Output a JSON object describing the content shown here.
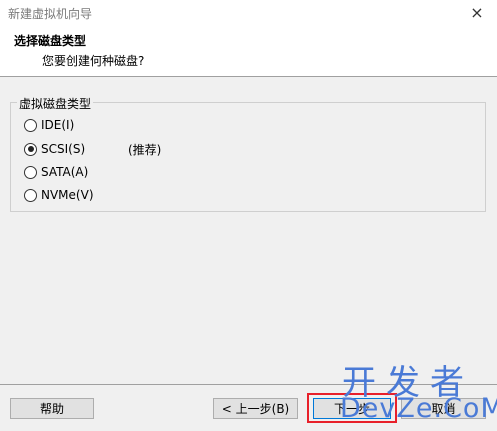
{
  "window": {
    "title": "新建虚拟机向导",
    "close_glyph": "×"
  },
  "header": {
    "title": "选择磁盘类型",
    "subtitle": "您要创建何种磁盘?"
  },
  "disk_type": {
    "group_label": "虚拟磁盘类型",
    "options": [
      {
        "label": "IDE(I)",
        "checked": false
      },
      {
        "label": "SCSI(S)",
        "checked": true,
        "note": "(推荐)"
      },
      {
        "label": "SATA(A)",
        "checked": false
      },
      {
        "label": "NVMe(V)",
        "checked": false
      }
    ]
  },
  "buttons": {
    "help": "帮助",
    "back": "< 上一步(B)",
    "next": "下一步",
    "cancel": "取消"
  },
  "watermark": {
    "top": "开发者",
    "bottom": "DevZe.CoM"
  },
  "colors": {
    "highlight": "#e8202a",
    "watermark": "#4a7ad6"
  }
}
